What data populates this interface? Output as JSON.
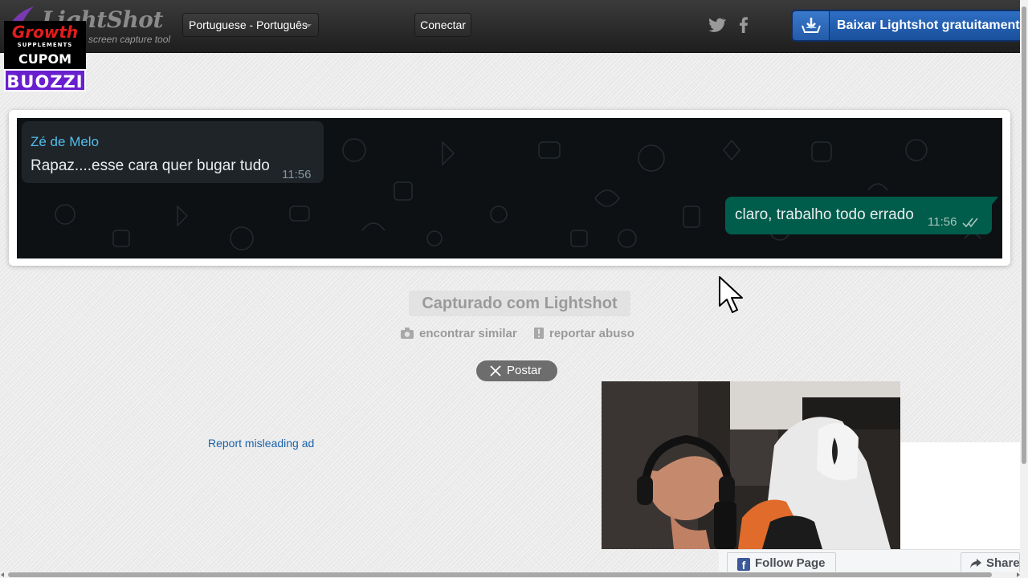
{
  "header": {
    "logo_text": "LightShot",
    "logo_subtitle": "screen capture tool",
    "language_selected": "Portuguese - Português",
    "connect_label": "Conectar",
    "download_label": "Baixar Lightshot gratuitamente"
  },
  "promo": {
    "brand": "Growth",
    "brand_sub": "SUPPLEMENTS",
    "cupom_label": "CUPOM",
    "code": "BUOZZI"
  },
  "screenshot": {
    "incoming": {
      "sender": "Zé de Melo",
      "text": "Rapaz....esse cara quer bugar tudo",
      "time": "11:56"
    },
    "outgoing": {
      "text": "claro, trabalho todo errado",
      "time": "11:56"
    }
  },
  "actions": {
    "captured_label": "Capturado com Lightshot",
    "find_similar": "encontrar similar",
    "report_abuse": "reportar abuso",
    "post_label": "Postar"
  },
  "ad": {
    "report_label": "Report misleading ad"
  },
  "facebook": {
    "follow_label": "Follow Page",
    "share_label": "Share"
  },
  "colors": {
    "header_bg": "#2a2a2a",
    "download_blue": "#1a4f9c",
    "whatsapp_in": "#1e2428",
    "whatsapp_out": "#005c4b",
    "sender_blue": "#53bdeb",
    "link_blue": "#1a63a8"
  }
}
